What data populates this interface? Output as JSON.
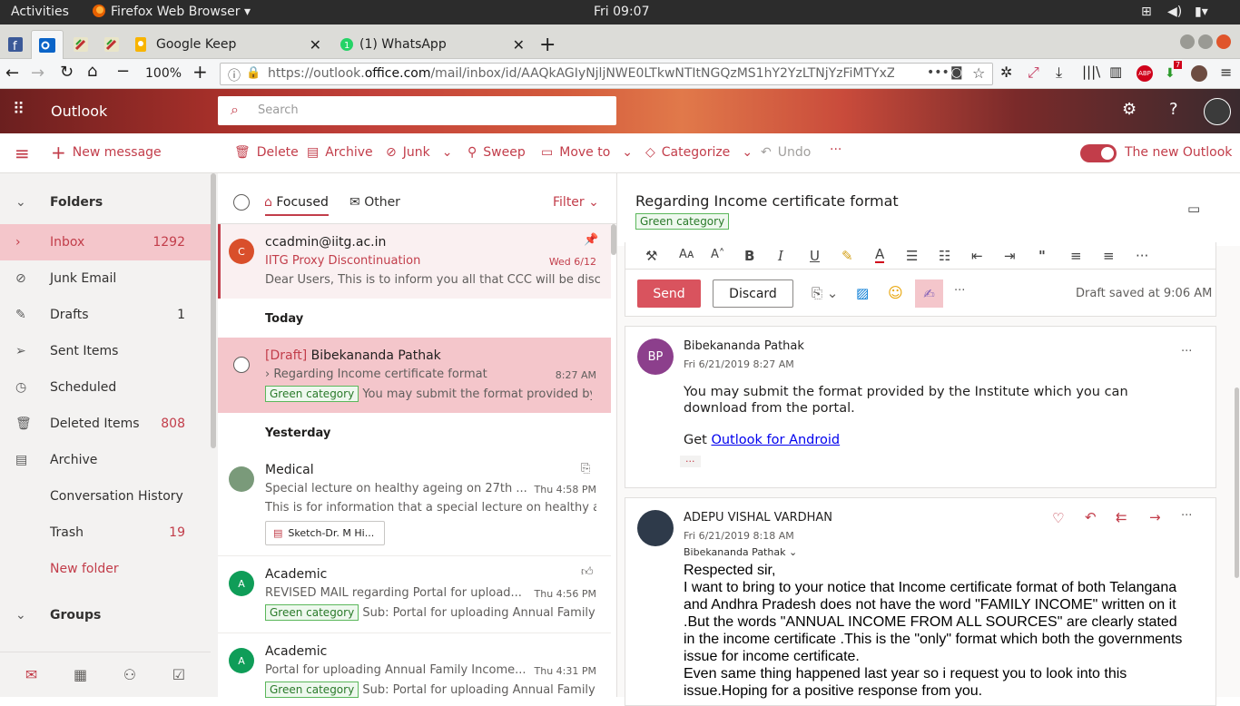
{
  "gnome": {
    "activities": "Activities",
    "app": "Firefox Web Browser",
    "clock": "Fri 09:07"
  },
  "tabs": [
    {
      "label": "Google Keep"
    },
    {
      "label": "(1) WhatsApp"
    }
  ],
  "nav": {
    "zoom": "100%",
    "url_prefix": "https://outlook.",
    "url_domain": "office.com",
    "url_rest": "/mail/inbox/id/AAQkAGIyNjljNWE0LTkwNTItNGQzMS1hY2YzLTNjYzFiMTYxZj",
    "abp_badge": "ABP",
    "dl_badge": "7"
  },
  "outlook": {
    "brand": "Outlook",
    "search_placeholder": "Search"
  },
  "commands": {
    "new_message": "New message",
    "delete": "Delete",
    "archive": "Archive",
    "junk": "Junk",
    "sweep": "Sweep",
    "move_to": "Move to",
    "categorize": "Categorize",
    "undo": "Undo",
    "more": "···",
    "new_outlook": "The new Outlook"
  },
  "folders": {
    "header": "Folders",
    "items": [
      {
        "label": "Inbox",
        "count": "1292"
      },
      {
        "label": "Junk Email",
        "count": ""
      },
      {
        "label": "Drafts",
        "count": "1"
      },
      {
        "label": "Sent Items",
        "count": ""
      },
      {
        "label": "Scheduled",
        "count": ""
      },
      {
        "label": "Deleted Items",
        "count": "808"
      },
      {
        "label": "Archive",
        "count": ""
      },
      {
        "label": "Conversation History",
        "count": ""
      },
      {
        "label": "Trash",
        "count": "19"
      },
      {
        "label": "New folder",
        "count": ""
      }
    ],
    "groups": "Groups"
  },
  "list": {
    "focused": "Focused",
    "other": "Other",
    "filter": "Filter",
    "today": "Today",
    "yesterday": "Yesterday",
    "messages": [
      {
        "avatar": "C",
        "sender": "ccadmin@iitg.ac.in",
        "subject": "IITG Proxy Discontinuation",
        "date": "Wed 6/12",
        "preview": "Dear Users, This is to inform you all that CCC will be disco..."
      },
      {
        "draft": "[Draft]",
        "sender": "Bibekananda Pathak",
        "subject": "Regarding Income certificate format",
        "date": "8:27 AM",
        "category": "Green category",
        "preview": "You may submit the format provided by t..."
      },
      {
        "sender": "Medical",
        "subject": "Special lecture on healthy ageing on 27th ...",
        "date": "Thu 4:58 PM",
        "preview": "This is for information that a special lecture on healthy ag...",
        "attachment": "Sketch-Dr. M Hi..."
      },
      {
        "avatar": "A",
        "sender": "Academic",
        "subject": "REVISED MAIL regarding Portal for upload...",
        "date": "Thu 4:56 PM",
        "category": "Green category",
        "preview": "Sub: Portal for uploading Annual Family In..."
      },
      {
        "avatar": "A",
        "sender": "Academic",
        "subject": "Portal for uploading Annual Family Income...",
        "date": "Thu 4:31 PM",
        "category": "Green category",
        "preview": "Sub: Portal for uploading Annual Family In..."
      }
    ]
  },
  "reading": {
    "title": "Regarding Income certificate format",
    "category": "Green category",
    "send": "Send",
    "discard": "Discard",
    "draft_saved": "Draft saved at 9:06 AM",
    "msg1": {
      "initials": "BP",
      "sender": "Bibekananda Pathak",
      "date": "Fri 6/21/2019 8:27 AM",
      "body": "You may submit the format provided by the Institute which you can download from the portal.",
      "get": "Get",
      "link": "Outlook for Android",
      "dots": "···"
    },
    "msg2": {
      "sender": "ADEPU VISHAL VARDHAN",
      "date": "Fri 6/21/2019 8:18 AM",
      "to": "Bibekananda Pathak",
      "lines": [
        "Respected sir,",
        "I want to bring to your notice that Income certificate format of both Telangana",
        "and Andhra Pradesh does not have the word \"FAMILY INCOME\" written on it",
        ".But the words \"ANNUAL INCOME FROM ALL SOURCES\" are clearly stated",
        "in the income certificate .This is the \"only\" format which both the governments",
        "issue for income certificate.",
        "Even same thing happened last year so i request you to look into this",
        "issue.Hoping for  a positive response from you."
      ]
    }
  },
  "colors": {
    "accent": "#c23d4a",
    "selected": "#f4c6cb",
    "green": "#5bb75b"
  }
}
